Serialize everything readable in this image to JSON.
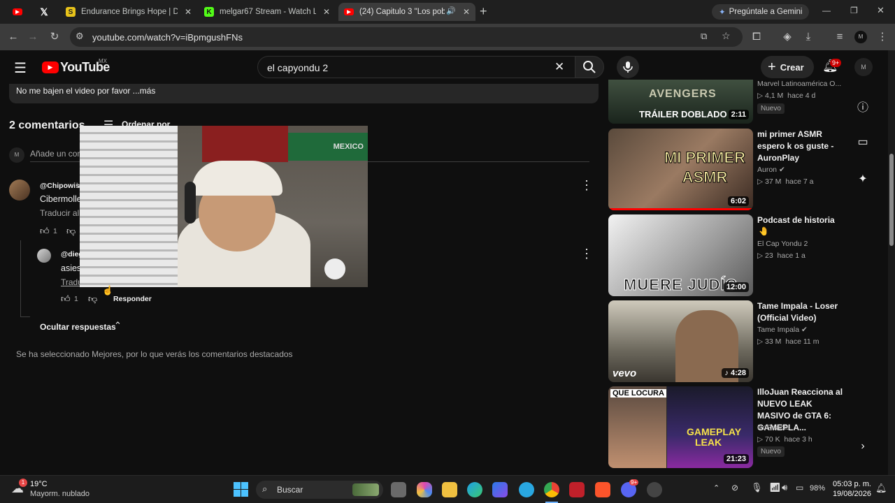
{
  "tabs": [
    {
      "title": "",
      "kind": "youtube"
    },
    {
      "title": "",
      "kind": "x"
    },
    {
      "title": "Endurance Brings Hope | Diapo",
      "kind": "slides"
    },
    {
      "title": "melgar67 Stream - Watch Live o",
      "kind": "kick"
    },
    {
      "title": "(24) Capitulo 3 \"Los pobres",
      "kind": "youtube-active"
    }
  ],
  "gemini_label": "Pregúntale a Gemini",
  "address": {
    "url": "youtube.com/watch?v=iBpmgushFNs"
  },
  "youtube": {
    "logo_text": "YouTube",
    "region": "MX",
    "search_value": "el capyondu 2",
    "create_label": "Crear",
    "notif_badge": "9+"
  },
  "description": {
    "text": "No me bajen el video por favor ...más"
  },
  "comments": {
    "count_label": "2 comentarios",
    "sort_label": "Ordenar por",
    "add_placeholder": "Añade un com",
    "items": [
      {
        "author": "@Chipowis",
        "author_suffix": "h",
        "text": "Cibermolle",
        "translate": "Traducir al",
        "likes": "1"
      },
      {
        "author": "@dieg",
        "text": "asies",
        "translate": "Tradu",
        "likes": "1",
        "reply_label": "Responder"
      }
    ],
    "hide_replies": "Ocultar respuestas",
    "footer_note": "Se ha seleccionado Mejores, por lo que verás los comentarios destacados"
  },
  "recommendations": [
    {
      "title": "",
      "channel": "Marvel Latinoamérica O...",
      "views": "4,1 M",
      "age": "hace 4 d",
      "badge": "Nuevo",
      "duration": "2:11",
      "thumb_text": "TRÁILER DOBLADO",
      "thumb_logo": "AVENGERS"
    },
    {
      "title": "mi primer ASMR espero k os guste - AuronPlay",
      "channel": "Auron",
      "views": "37 M",
      "age": "hace 7 a",
      "duration": "6:02",
      "thumb_text": "MI PRIMER ASMR"
    },
    {
      "title": "Podcast de historia",
      "channel": "El Cap Yondu 2",
      "views": "23",
      "age": "hace 1 a",
      "duration": "12:00",
      "thumb_text": "MUERE JUDÍC"
    },
    {
      "title": "Tame Impala - Loser (Official Video)",
      "channel": "Tame Impala",
      "views": "33 M",
      "age": "hace 11 m",
      "duration": "4:28",
      "thumb_text": "vevo"
    },
    {
      "title": "IlloJuan Reacciona al NUEVO LEAK MASIVO de GTA 6: GAMEPLA...",
      "channel": "IlloReacts",
      "views": "70 K",
      "age": "hace 3 h",
      "badge": "Nuevo",
      "duration": "21:23",
      "thumb_text": "QUE LOCURA",
      "thumb_text2": "GAMEPLAY LEAK"
    }
  ],
  "taskbar": {
    "temp": "19°C",
    "weather": "Mayorm. nublado",
    "weather_badge": "1",
    "search_label": "Buscar",
    "battery": "98%",
    "time": "05:03 p. m.",
    "date": "19/08/2026",
    "discord_badge": "9+"
  },
  "colors": {
    "yt_red": "#ff0000",
    "bg": "#0f0f0f",
    "tabbar": "#1f1f1f"
  }
}
